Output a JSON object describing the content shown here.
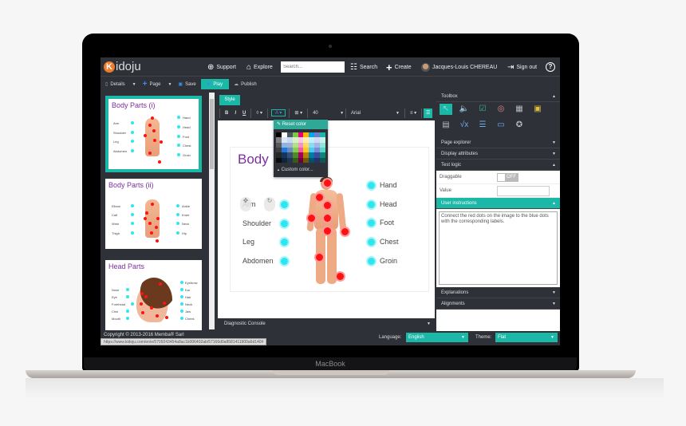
{
  "device": {
    "label": "MacBook"
  },
  "header": {
    "logo": {
      "initial": "K",
      "rest": "idoju"
    },
    "nav": {
      "support": "Support",
      "explore": "Explore",
      "search_placeholder": "Search...",
      "search": "Search",
      "create": "Create",
      "user": "Jacques-Louis CHEREAU",
      "sign_out": "Sign out",
      "help": "?"
    }
  },
  "toolbar": {
    "details": "Details",
    "page": "Page",
    "save": "Save",
    "play": "Play",
    "publish": "Publish"
  },
  "pages": [
    {
      "title": "Body Parts (i)",
      "left": [
        "Arm",
        "Shoulder",
        "Leg",
        "Abdomen"
      ],
      "right": [
        "Hand",
        "Head",
        "Foot",
        "Chest",
        "Groin"
      ],
      "active": true
    },
    {
      "title": "Body Parts (ii)",
      "left": [
        "Elbow",
        "Calf",
        "Wrist",
        "Thigh"
      ],
      "right": [
        "Ankle",
        "Knee",
        "Neck",
        "Hip"
      ],
      "active": false
    },
    {
      "title": "Head Parts",
      "left": [
        "Nose",
        "Eye",
        "Forehead",
        "Chin",
        "Mouth"
      ],
      "right": [
        "Eyebrow",
        "Ear",
        "Hair",
        "Neck",
        "Jaw",
        "Cheek"
      ],
      "active": false
    }
  ],
  "editor": {
    "tab": "Style",
    "format": {
      "bold": "B",
      "italic": "I",
      "underline": "U",
      "font_size": "40",
      "font_family": "Arial"
    },
    "color_popup": {
      "reset": "Reset color",
      "custom": "Custom color..."
    },
    "canvas": {
      "title": "Body",
      "left_labels": [
        "Arm",
        "Shoulder",
        "Leg",
        "Abdomen"
      ],
      "right_labels": [
        "Hand",
        "Head",
        "Foot",
        "Chest",
        "Groin"
      ]
    },
    "console": "Diagnostic Console"
  },
  "right_panel": {
    "toolbox": "Toolbox",
    "page_explorer": "Page explorer",
    "display_attributes": "Display attributes",
    "test_logic": "Test logic",
    "draggable_label": "Draggable",
    "draggable_value": "OFF",
    "value_label": "Value",
    "user_instructions": "User instructions",
    "instructions_text": "Connect the red dots on the image to the blue dots with the corresponding labels.",
    "explanations": "Explanations",
    "alignments": "Alignments"
  },
  "footer": {
    "copyright": "Copyright © 2013-2016 Memba® Sarl",
    "language_label": "Language:",
    "language": "English",
    "theme_label": "Theme:",
    "theme": "Flat",
    "status_url": "https://www.kidoju.com/en/e/5709243454a8ac1b006402ab/57166d0a8581411900a6d140#"
  },
  "colors": {
    "accent": "#1bb8a8",
    "dark": "#2f3138",
    "title_purple": "#7b2ea0",
    "logo_orange": "#f07b2a"
  }
}
